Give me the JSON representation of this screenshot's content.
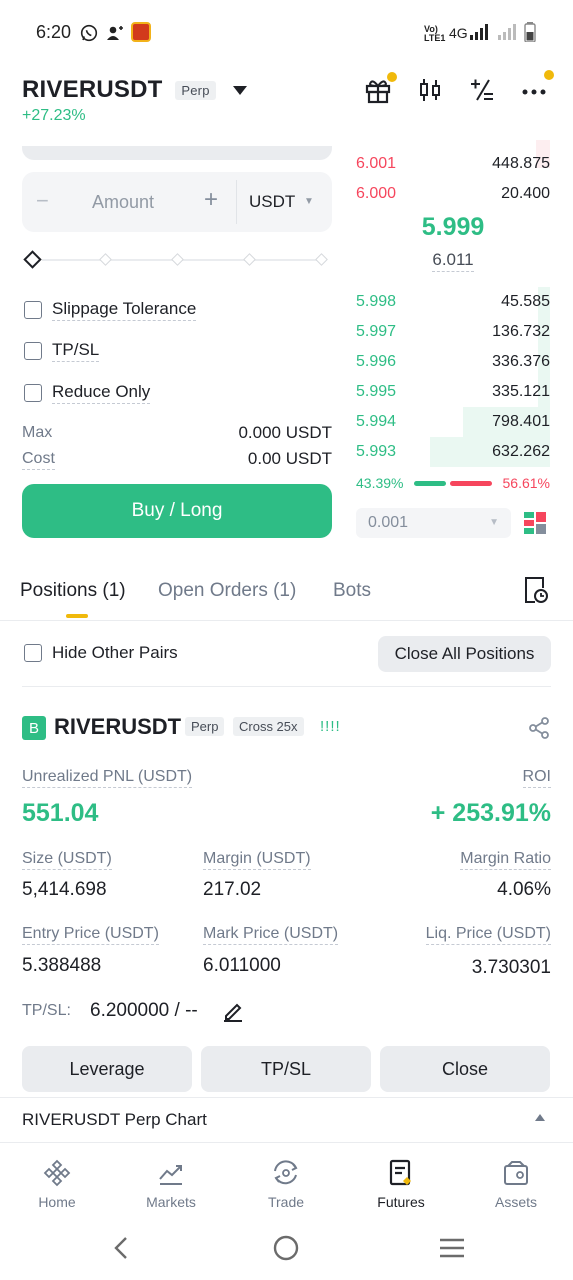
{
  "status_bar": {
    "time": "6:20",
    "network": "4G",
    "volte": "VoLTE1"
  },
  "header": {
    "symbol": "RIVERUSDT",
    "contract_type": "Perp",
    "change": "+27.23%"
  },
  "order_form": {
    "amount_placeholder": "Amount",
    "amount_unit": "USDT",
    "minus": "−",
    "plus": "+",
    "checkboxes": [
      "Slippage Tolerance",
      "TP/SL",
      "Reduce Only"
    ],
    "max_label": "Max",
    "max_value": "0.000 USDT",
    "cost_label": "Cost",
    "cost_value": "0.00 USDT",
    "submit_label": "Buy / Long"
  },
  "order_book": {
    "asks": [
      {
        "price": "6.001",
        "qty": "448.875"
      },
      {
        "price": "6.000",
        "qty": "20.400"
      }
    ],
    "last_price": "5.999",
    "mark_price": "6.011",
    "bids": [
      {
        "price": "5.998",
        "qty": "45.585",
        "depth": 0.06
      },
      {
        "price": "5.997",
        "qty": "136.732",
        "depth": 0.06
      },
      {
        "price": "5.996",
        "qty": "336.376",
        "depth": 0.06
      },
      {
        "price": "5.995",
        "qty": "335.121",
        "depth": 0.06
      },
      {
        "price": "5.994",
        "qty": "798.401",
        "depth": 0.45
      },
      {
        "price": "5.993",
        "qty": "632.262",
        "depth": 0.62
      }
    ],
    "buy_ratio": "43.39%",
    "sell_ratio": "56.61%",
    "buy_ratio_value": 0.4339,
    "precision": "0.001"
  },
  "tabs": {
    "positions": "Positions (1)",
    "open_orders": "Open Orders (1)",
    "bots": "Bots"
  },
  "positions_toolbar": {
    "hide_other_pairs": "Hide Other Pairs",
    "close_all": "Close All Positions"
  },
  "position": {
    "side_badge": "B",
    "symbol": "RIVERUSDT",
    "contract_type": "Perp",
    "margin_mode": "Cross 25x",
    "signal": "!!!!",
    "unrealized_pnl_label": "Unrealized PNL (USDT)",
    "unrealized_pnl": "551.04",
    "roi_label": "ROI",
    "roi": "+ 253.91%",
    "size_label": "Size (USDT)",
    "size": "5,414.698",
    "margin_label": "Margin (USDT)",
    "margin": "217.02",
    "margin_ratio_label": "Margin Ratio",
    "margin_ratio": "4.06%",
    "entry_price_label": "Entry Price (USDT)",
    "entry_price": "5.388488",
    "mark_price_label": "Mark Price (USDT)",
    "mark_price": "6.011000",
    "liq_price_label": "Liq. Price (USDT)",
    "liq_price": "3.730301",
    "tpsl_label": "TP/SL:",
    "tpsl_value": "6.200000 / --",
    "actions": [
      "Leverage",
      "TP/SL",
      "Close"
    ]
  },
  "chart_panel": {
    "title": "RIVERUSDT Perp Chart"
  },
  "bottom_nav": [
    {
      "label": "Home",
      "icon": "home-icon"
    },
    {
      "label": "Markets",
      "icon": "markets-icon"
    },
    {
      "label": "Trade",
      "icon": "trade-icon"
    },
    {
      "label": "Futures",
      "icon": "futures-icon",
      "active": true
    },
    {
      "label": "Assets",
      "icon": "assets-icon"
    }
  ],
  "colors": {
    "green": "#2ebd85",
    "red": "#f6465d",
    "accent": "#f0b90b"
  }
}
